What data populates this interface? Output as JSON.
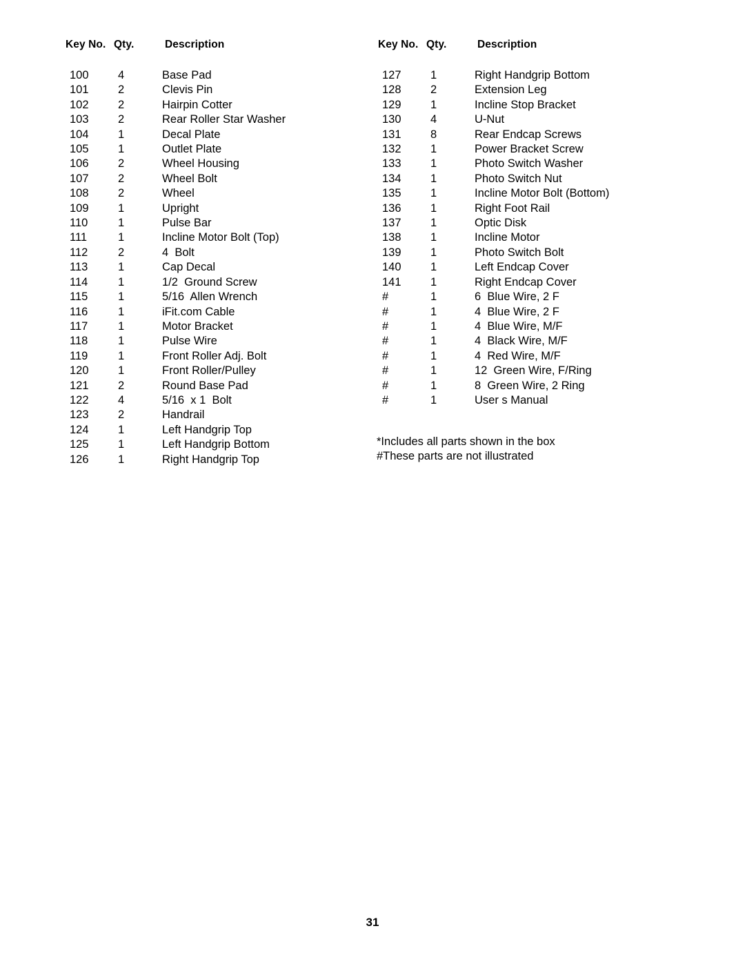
{
  "document": {
    "page_number": "31"
  },
  "columns": [
    {
      "headers": {
        "key": "Key No.",
        "qty": "Qty.",
        "description": "Description"
      },
      "rows": [
        {
          "key": "100",
          "qty": "4",
          "description": "Base Pad"
        },
        {
          "key": "101",
          "qty": "2",
          "description": "Clevis Pin"
        },
        {
          "key": "102",
          "qty": "2",
          "description": "Hairpin Cotter"
        },
        {
          "key": "103",
          "qty": "2",
          "description": "Rear Roller Star Washer"
        },
        {
          "key": "104",
          "qty": "1",
          "description": "Decal Plate"
        },
        {
          "key": "105",
          "qty": "1",
          "description": "Outlet Plate"
        },
        {
          "key": "106",
          "qty": "2",
          "description": "Wheel Housing"
        },
        {
          "key": "107",
          "qty": "2",
          "description": "Wheel Bolt"
        },
        {
          "key": "108",
          "qty": "2",
          "description": "Wheel"
        },
        {
          "key": "109",
          "qty": "1",
          "description": "Upright"
        },
        {
          "key": "110",
          "qty": "1",
          "description": "Pulse Bar"
        },
        {
          "key": "111",
          "qty": "1",
          "description": "Incline Motor Bolt (Top)"
        },
        {
          "key": "112",
          "qty": "2",
          "description": "4  Bolt"
        },
        {
          "key": "113",
          "qty": "1",
          "description": "Cap Decal"
        },
        {
          "key": "114",
          "qty": "1",
          "description": "1/2  Ground Screw"
        },
        {
          "key": "115",
          "qty": "1",
          "description": "5/16  Allen Wrench"
        },
        {
          "key": "116",
          "qty": "1",
          "description": "iFit.com Cable"
        },
        {
          "key": "117",
          "qty": "1",
          "description": "Motor Bracket"
        },
        {
          "key": "118",
          "qty": "1",
          "description": "Pulse Wire"
        },
        {
          "key": "119",
          "qty": "1",
          "description": "Front Roller Adj. Bolt"
        },
        {
          "key": "120",
          "qty": "1",
          "description": "Front Roller/Pulley"
        },
        {
          "key": "121",
          "qty": "2",
          "description": "Round Base Pad"
        },
        {
          "key": "122",
          "qty": "4",
          "description": "5/16  x 1  Bolt"
        },
        {
          "key": "123",
          "qty": "2",
          "description": "Handrail"
        },
        {
          "key": "124",
          "qty": "1",
          "description": "Left Handgrip Top"
        },
        {
          "key": "125",
          "qty": "1",
          "description": "Left Handgrip Bottom"
        },
        {
          "key": "126",
          "qty": "1",
          "description": "Right Handgrip Top"
        }
      ]
    },
    {
      "headers": {
        "key": "Key No.",
        "qty": "Qty.",
        "description": "Description"
      },
      "rows": [
        {
          "key": "127",
          "qty": "1",
          "description": "Right Handgrip Bottom"
        },
        {
          "key": "128",
          "qty": "2",
          "description": "Extension Leg"
        },
        {
          "key": "129",
          "qty": "1",
          "description": "Incline Stop Bracket"
        },
        {
          "key": "130",
          "qty": "4",
          "description": "U-Nut"
        },
        {
          "key": "131",
          "qty": "8",
          "description": "Rear Endcap Screws"
        },
        {
          "key": "132",
          "qty": "1",
          "description": "Power Bracket Screw"
        },
        {
          "key": "133",
          "qty": "1",
          "description": "Photo Switch Washer"
        },
        {
          "key": "134",
          "qty": "1",
          "description": "Photo Switch Nut"
        },
        {
          "key": "135",
          "qty": "1",
          "description": "Incline Motor Bolt (Bottom)"
        },
        {
          "key": "136",
          "qty": "1",
          "description": "Right Foot Rail"
        },
        {
          "key": "137",
          "qty": "1",
          "description": "Optic Disk"
        },
        {
          "key": "138",
          "qty": "1",
          "description": "Incline Motor"
        },
        {
          "key": "139",
          "qty": "1",
          "description": "Photo Switch Bolt"
        },
        {
          "key": "140",
          "qty": "1",
          "description": "Left Endcap Cover"
        },
        {
          "key": "141",
          "qty": "1",
          "description": "Right Endcap Cover"
        },
        {
          "key": "#",
          "qty": "1",
          "description": "6  Blue Wire, 2 F"
        },
        {
          "key": "#",
          "qty": "1",
          "description": "4  Blue Wire, 2 F"
        },
        {
          "key": "#",
          "qty": "1",
          "description": "4  Blue Wire, M/F"
        },
        {
          "key": "#",
          "qty": "1",
          "description": "4  Black Wire, M/F"
        },
        {
          "key": "#",
          "qty": "1",
          "description": "4  Red Wire, M/F"
        },
        {
          "key": "#",
          "qty": "1",
          "description": "12  Green Wire, F/Ring"
        },
        {
          "key": "#",
          "qty": "1",
          "description": "8  Green Wire, 2 Ring"
        },
        {
          "key": "#",
          "qty": "1",
          "description": "User s Manual"
        }
      ]
    }
  ],
  "footnotes": [
    "*Includes all parts shown in the box",
    "#These parts are not illustrated"
  ]
}
